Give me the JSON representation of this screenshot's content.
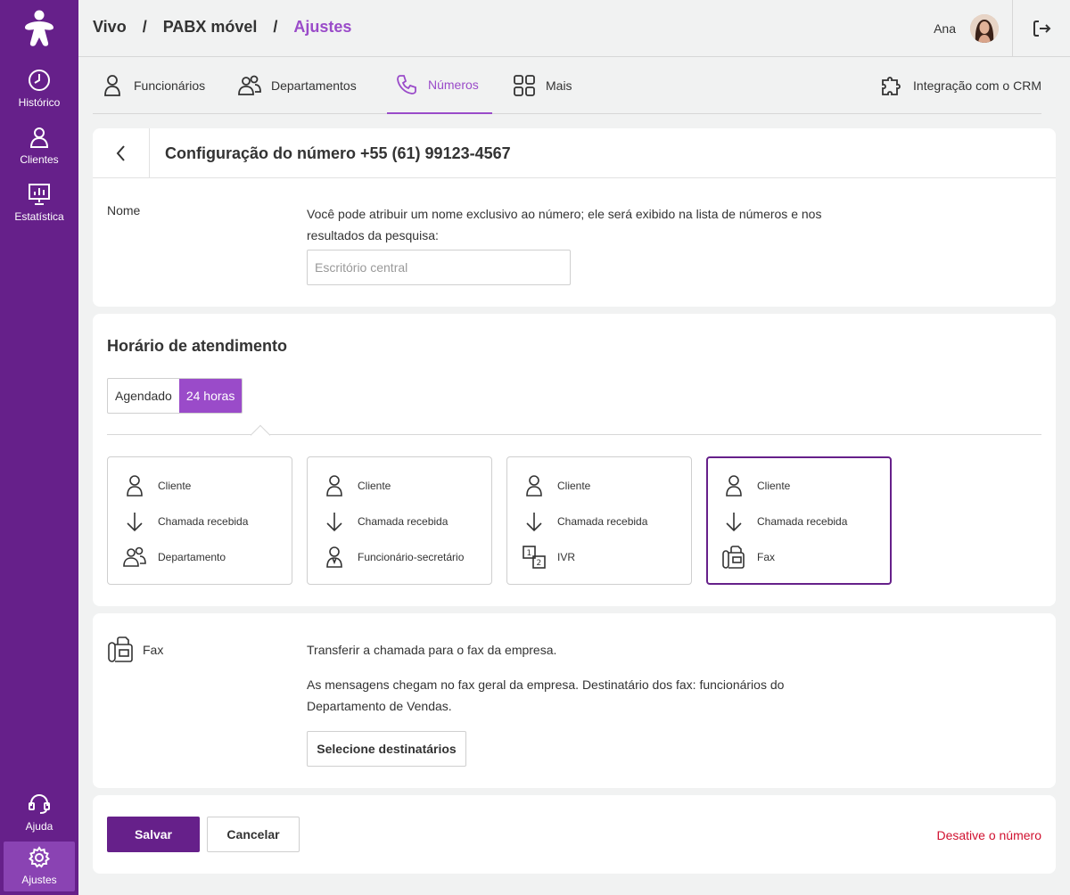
{
  "colors": {
    "brand": "#66208a",
    "accent": "#9a4bc9",
    "danger": "#d0102f"
  },
  "sidebar": {
    "logo": "vivo-logo",
    "items": [
      {
        "label": "Histórico",
        "icon": "clock-icon"
      },
      {
        "label": "Clientes",
        "icon": "person-icon"
      },
      {
        "label": "Estatística",
        "icon": "chart-board-icon"
      },
      {
        "label": "Ajuda",
        "icon": "headset-icon"
      },
      {
        "label": "Ajustes",
        "icon": "gear-icon",
        "active": true
      }
    ]
  },
  "header": {
    "breadcrumb": [
      "Vivo",
      "PABX móvel",
      "Ajustes"
    ],
    "separator": "/",
    "user": "Ana",
    "logout_icon": "logout-icon"
  },
  "tabs": [
    {
      "label": "Funcionários",
      "icon": "person-icon"
    },
    {
      "label": "Departamentos",
      "icon": "people-icon"
    },
    {
      "label": "Números",
      "icon": "phone-icon",
      "active": true
    },
    {
      "label": "Mais",
      "icon": "grid-icon"
    },
    {
      "label": "Integração com o CRM",
      "icon": "puzzle-icon"
    }
  ],
  "config": {
    "title": "Configuração do número +55 (61) 99123-4567",
    "nome_label": "Nome",
    "nome_desc": "Você pode atribuir um nome exclusivo ao número; ele será exibido na lista de números e nos resultados da pesquisa:",
    "nome_placeholder": "Escritório central",
    "nome_value": ""
  },
  "schedule": {
    "title": "Horário de atendimento",
    "options": [
      "Agendado",
      "24 horas"
    ],
    "selected": "24 horas",
    "flows": [
      {
        "rows": [
          "Cliente",
          "Chamada recebida",
          "Departamento"
        ]
      },
      {
        "rows": [
          "Cliente",
          "Chamada recebida",
          "Funcionário-secretário"
        ]
      },
      {
        "rows": [
          "Cliente",
          "Chamada recebida",
          "IVR"
        ]
      },
      {
        "rows": [
          "Cliente",
          "Chamada recebida",
          "Fax"
        ],
        "selected": true
      }
    ]
  },
  "fax": {
    "label": "Fax",
    "text1": "Transferir a chamada para o fax da empresa.",
    "text2": "As mensagens chegam no fax geral da empresa. Destinatário dos fax: funcionários do Departamento de Vendas.",
    "select_button": "Selecione destinatários"
  },
  "actions": {
    "save": "Salvar",
    "cancel": "Cancelar",
    "deactivate": "Desative o número"
  }
}
